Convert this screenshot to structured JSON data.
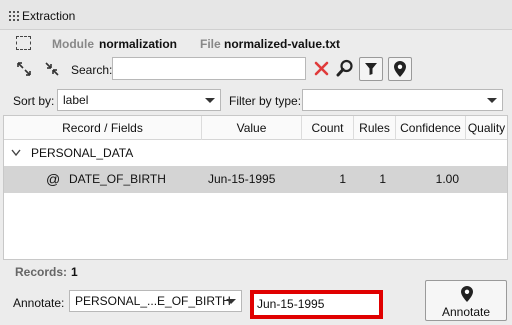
{
  "window": {
    "title": "Extraction"
  },
  "meta": {
    "module_label": "Module",
    "module_value": "normalization",
    "file_label": "File",
    "file_value": "normalized-value.txt"
  },
  "search": {
    "label": "Search:",
    "value": ""
  },
  "sort": {
    "label": "Sort by:",
    "value": "label"
  },
  "filter": {
    "label": "Filter by type:",
    "value": ""
  },
  "table": {
    "columns": [
      "Record / Fields",
      "Value",
      "Count",
      "Rules",
      "Confidence",
      "Quality"
    ],
    "group": "PERSONAL_DATA",
    "rows": [
      {
        "icon": "@",
        "field": "DATE_OF_BIRTH",
        "value": "Jun-15-1995",
        "count": "1",
        "rules": "1",
        "confidence": "1.00",
        "quality": ""
      }
    ]
  },
  "records": {
    "label": "Records:",
    "value": "1"
  },
  "annotate": {
    "label": "Annotate:",
    "field_value": "PERSONAL_...E_OF_BIRTH",
    "input_value": "Jun-15-1995",
    "button_label": "Annotate"
  },
  "colors": {
    "clear_icon": "#e03a3a",
    "highlight_border": "#e00000",
    "selected_row": "#d4d4d4"
  }
}
